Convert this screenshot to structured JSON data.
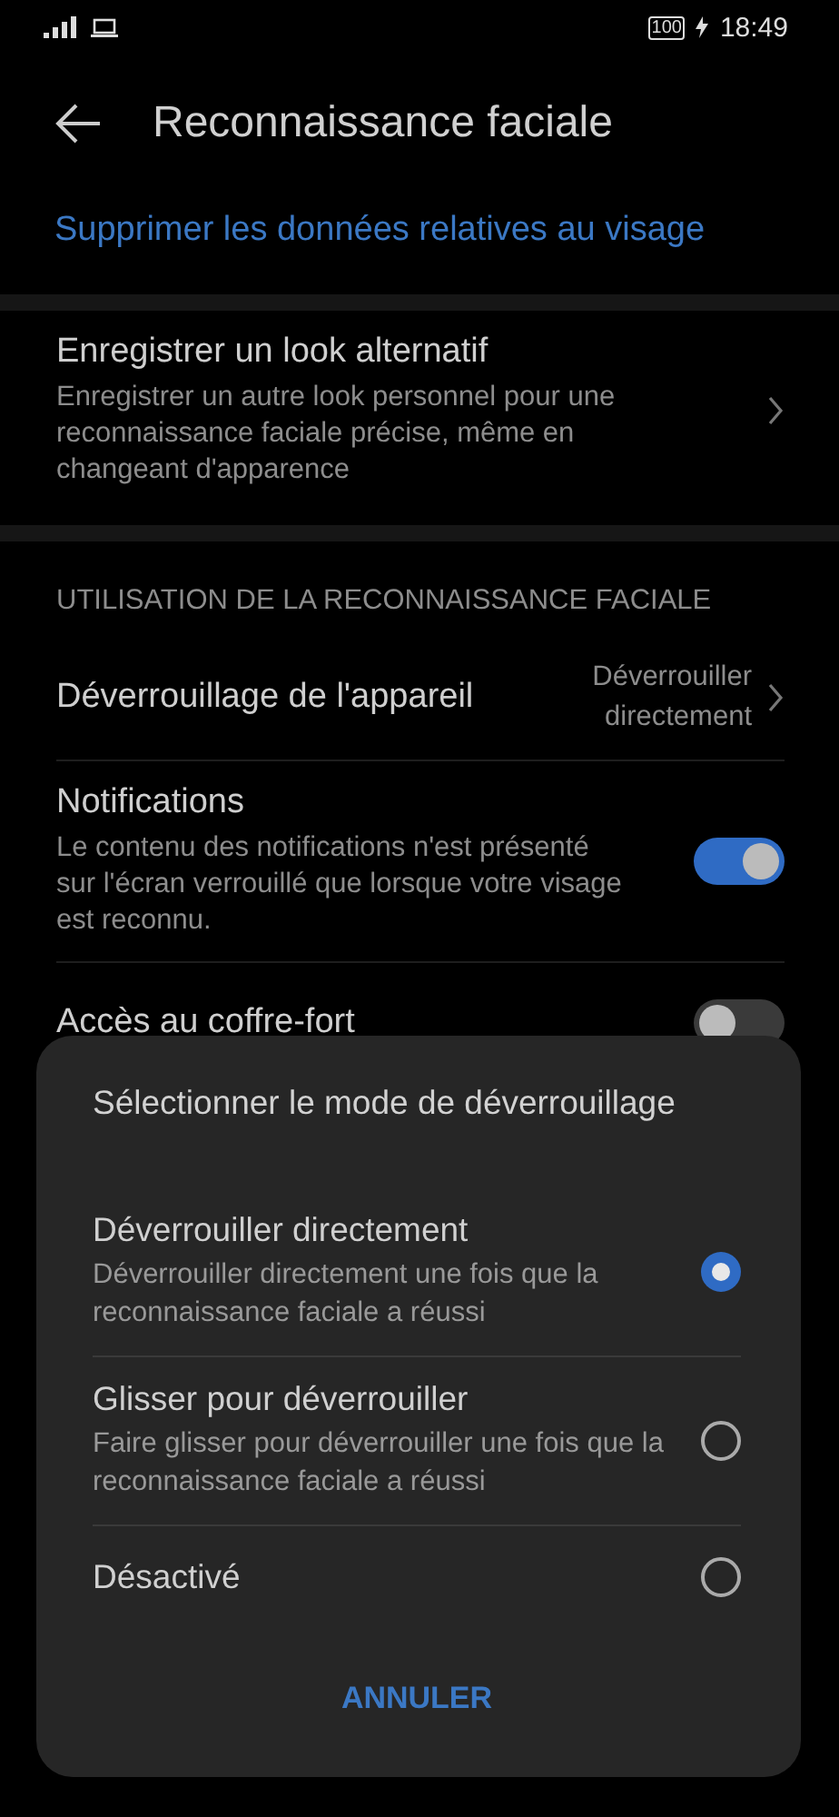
{
  "status_bar": {
    "battery": "100",
    "time": "18:49"
  },
  "header": {
    "title": "Reconnaissance faciale"
  },
  "delete_link": "Supprimer les données relatives au visage",
  "alternate_look": {
    "title": "Enregistrer un look alternatif",
    "description": "Enregistrer un autre look personnel pour une reconnaissance faciale précise, même en changeant d'apparence"
  },
  "section": {
    "heading": "UTILISATION DE LA RECONNAISSANCE FACIALE",
    "items": [
      {
        "kind": "value",
        "title": "Déverrouillage de l'appareil",
        "value": "Déverrouiller directement"
      },
      {
        "kind": "toggle",
        "title": "Notifications",
        "description": "Le contenu des notifications n'est présenté sur l'écran verrouillé que lorsque votre visage est reconnu.",
        "on": true
      },
      {
        "kind": "toggle",
        "title": "Accès au coffre-fort",
        "on": false
      }
    ]
  },
  "dialog": {
    "title": "Sélectionner le mode de déverrouillage",
    "options": [
      {
        "title": "Déverrouiller directement",
        "description": "Déverrouiller directement une fois que la reconnaissance faciale a réussi",
        "selected": true
      },
      {
        "title": "Glisser pour déverrouiller",
        "description": "Faire glisser pour déverrouiller une fois que la reconnaissance faciale a réussi",
        "selected": false
      },
      {
        "title": "Désactivé",
        "selected": false
      }
    ],
    "cancel": "ANNULER"
  }
}
